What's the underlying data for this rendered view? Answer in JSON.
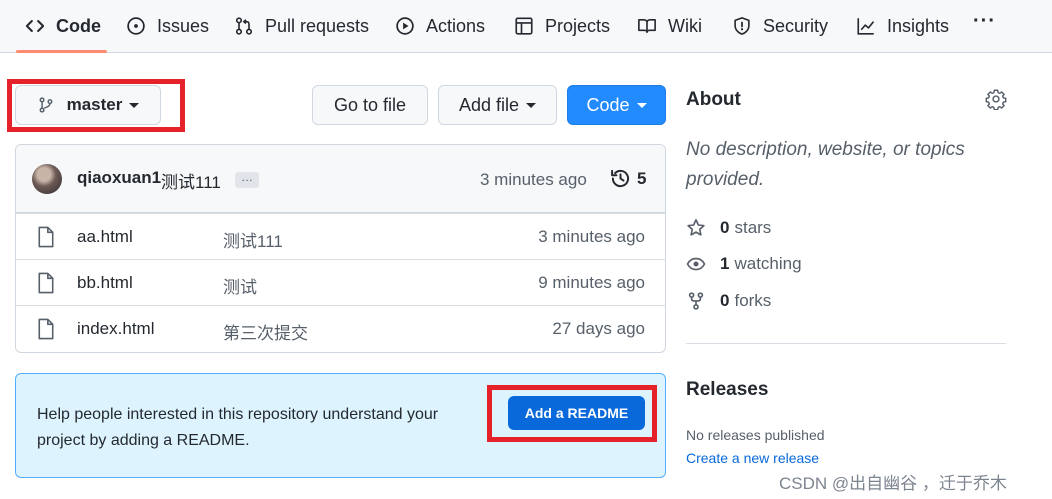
{
  "nav": {
    "tabs": [
      {
        "label": "Code",
        "icon": "code-icon"
      },
      {
        "label": "Issues",
        "icon": "issue-opened-icon"
      },
      {
        "label": "Pull requests",
        "icon": "git-pull-request-icon"
      },
      {
        "label": "Actions",
        "icon": "play-icon"
      },
      {
        "label": "Projects",
        "icon": "table-icon"
      },
      {
        "label": "Wiki",
        "icon": "book-icon"
      },
      {
        "label": "Security",
        "icon": "shield-icon"
      },
      {
        "label": "Insights",
        "icon": "graph-icon"
      }
    ],
    "selected": "Code",
    "more_label": "···"
  },
  "toolbar": {
    "branch": "master",
    "go_to_file": "Go to file",
    "add_file": "Add file",
    "code": "Code"
  },
  "commit": {
    "author": "qiaoxuan1",
    "message": "测试111",
    "ellipsis": "…",
    "time": "3 minutes ago",
    "count": "5"
  },
  "files": [
    {
      "name": "aa.html",
      "message": "测试111",
      "time": "3 minutes ago"
    },
    {
      "name": "bb.html",
      "message": "测试",
      "time": "9 minutes ago"
    },
    {
      "name": "index.html",
      "message": "第三次提交",
      "time": "27 days ago"
    }
  ],
  "readme": {
    "text": "Help people interested in this repository understand your project by adding a README.",
    "button": "Add a README"
  },
  "about": {
    "title": "About",
    "description": "No description, website, or topics provided.",
    "stars_count": "0",
    "stars_label": "stars",
    "watching_count": "1",
    "watching_label": "watching",
    "forks_count": "0",
    "forks_label": "forks"
  },
  "releases": {
    "title": "Releases",
    "none": "No releases published",
    "create_link": "Create a new release"
  },
  "watermark": "CSDN @出自幽谷 ，迁于乔木",
  "colors": {
    "accent_blue": "#218bff",
    "readme_button": "#0969da",
    "highlight_red": "#e5222a",
    "tab_underline": "#fd8c73"
  }
}
